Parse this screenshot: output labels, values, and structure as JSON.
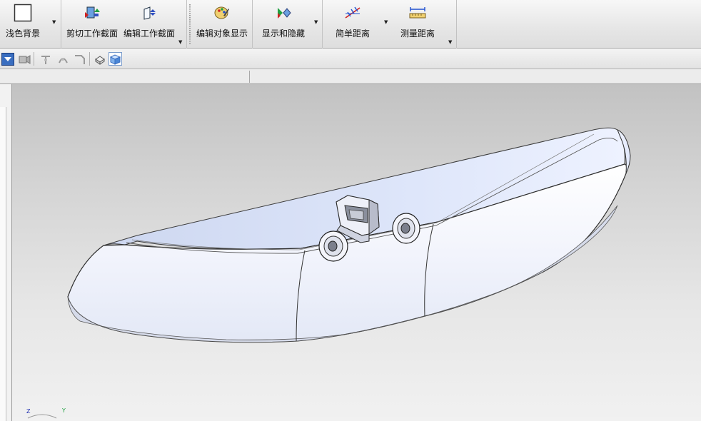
{
  "ribbon": {
    "buttons": [
      {
        "id": "light-background",
        "label": "浅色背景",
        "icon": "white-square-icon"
      },
      {
        "id": "clip-section",
        "label": "剪切工作截面",
        "icon": "clip-section-icon"
      },
      {
        "id": "edit-section",
        "label": "编辑工作截面",
        "icon": "edit-section-icon"
      },
      {
        "id": "edit-object-display",
        "label": "编辑对象显示",
        "icon": "palette-icon"
      },
      {
        "id": "show-hide",
        "label": "显示和隐藏",
        "icon": "show-hide-icon"
      },
      {
        "id": "simple-distance",
        "label": "简单距离",
        "icon": "simple-distance-icon"
      },
      {
        "id": "measure-distance",
        "label": "测量距离",
        "icon": "ruler-icon"
      }
    ]
  },
  "toolbar2": {
    "icons": [
      "view-dropdown-icon",
      "camera-icon",
      "snap-point-icon",
      "snap-arc-icon",
      "snap-edge-icon",
      "shaded-edges-icon",
      "shaded-cube-icon"
    ]
  },
  "triad": {
    "z": "Z",
    "y": "Y"
  }
}
